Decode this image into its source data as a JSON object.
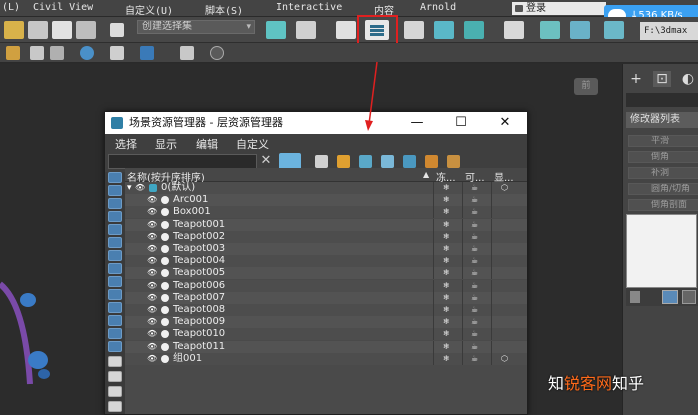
{
  "menubar": {
    "items": [
      "(L)",
      "Civil View",
      "自定义(U)",
      "脚本(S)",
      "Interactive",
      "内容",
      "Arnold"
    ],
    "login": "登录"
  },
  "net_speed": "↓536 KB/s",
  "toolbar": {
    "selection_set": "创建选择集",
    "path": "F:\\3dmax"
  },
  "viewport": {
    "viewcube_label": "前"
  },
  "command_panel": {
    "tabs": [
      "+",
      "⊡",
      "◐"
    ],
    "modifier_list": "修改器列表",
    "buttons": [
      "平滑",
      "倒角",
      "补洞",
      "圆角/切角",
      "倒角剖面"
    ]
  },
  "dialog": {
    "title": "场景资源管理器 - 层资源管理器",
    "minimize": "—",
    "maximize": "☐",
    "close": "✕",
    "menu": [
      "选择",
      "显示",
      "编辑",
      "自定义"
    ],
    "header": {
      "name": "名称(按升序排序)",
      "sort_arrow": "▲",
      "col1": "冻...",
      "col2": "可...",
      "col3": "显..."
    },
    "rows": [
      {
        "name": "0(默认)",
        "level": 0
      },
      {
        "name": "Arc001",
        "level": 1
      },
      {
        "name": "Box001",
        "level": 1
      },
      {
        "name": "Teapot001",
        "level": 1
      },
      {
        "name": "Teapot002",
        "level": 1
      },
      {
        "name": "Teapot003",
        "level": 1
      },
      {
        "name": "Teapot004",
        "level": 1
      },
      {
        "name": "Teapot005",
        "level": 1
      },
      {
        "name": "Teapot006",
        "level": 1
      },
      {
        "name": "Teapot007",
        "level": 1
      },
      {
        "name": "Teapot008",
        "level": 1
      },
      {
        "name": "Teapot009",
        "level": 1
      },
      {
        "name": "Teapot010",
        "level": 1
      },
      {
        "name": "Teapot011",
        "level": 1
      },
      {
        "name": "组001",
        "level": 1
      }
    ]
  },
  "watermark": {
    "prefix": "知",
    "highlight": "锐客网",
    "suffix": "知乎"
  },
  "colors": {
    "highlight_red": "#e02020",
    "accent_blue": "#3aa0f2"
  }
}
